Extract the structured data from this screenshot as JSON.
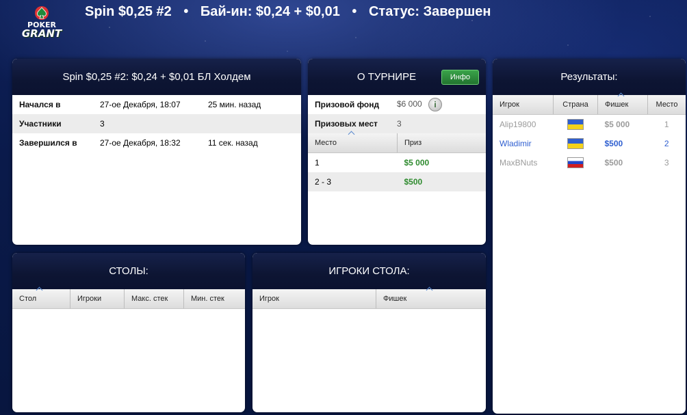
{
  "header": {
    "logo_top": "POKER",
    "logo_bottom": "GRANT",
    "title": "Spin $0,25 #2",
    "buyin": "Бай-ин: $0,24 + $0,01",
    "status": "Статус: Завершен",
    "separator": "•"
  },
  "tournament_panel": {
    "title": "Spin $0,25 #2: $0,24 + $0,01 БЛ Холдем",
    "rows": [
      {
        "label": "Начался в",
        "date": "27-ое Декабря, 18:07",
        "ago": "25 мин. назад"
      },
      {
        "label": "Участники",
        "date": "3",
        "ago": ""
      },
      {
        "label": "Завершился в",
        "date": "27-ое Декабря, 18:32",
        "ago": "11 сек. назад"
      }
    ]
  },
  "about_panel": {
    "title": "О ТУРНИРЕ",
    "info_button": "Инфо",
    "info_icon": "i",
    "prize_pool_label": "Призовой фонд",
    "prize_pool_value": "$6 000",
    "prize_places_label": "Призовых мест",
    "prize_places_value": "3",
    "columns": [
      "Место",
      "Приз"
    ],
    "rows": [
      {
        "place": "1",
        "prize": "$5 000"
      },
      {
        "place": "2 - 3",
        "prize": "$500"
      }
    ]
  },
  "results_panel": {
    "title": "Результаты:",
    "columns": [
      "Игрок",
      "Страна",
      "Фишек",
      "Место"
    ],
    "rows": [
      {
        "player": "Alip19800",
        "country": "ua-flag-icon",
        "chips": "$5 000",
        "place": "1"
      },
      {
        "player": "Wladimir",
        "country": "ua-flag-icon",
        "chips": "$500",
        "place": "2"
      },
      {
        "player": "MaxBNuts",
        "country": "ru-flag-icon",
        "chips": "$500",
        "place": "3"
      }
    ]
  },
  "tables_panel": {
    "title": "СТОЛЫ:",
    "columns": [
      "Стол",
      "Игроки",
      "Макс. стек",
      "Мин. стек"
    ]
  },
  "table_players_panel": {
    "title": "ИГРОКИ СТОЛА:",
    "columns": [
      "Игрок",
      "Фишек"
    ]
  },
  "colors": {
    "background": "#0b1a46",
    "panel_header": "#0d1533",
    "green": "#2f8b2f",
    "blue_link": "#2f5fd0"
  }
}
